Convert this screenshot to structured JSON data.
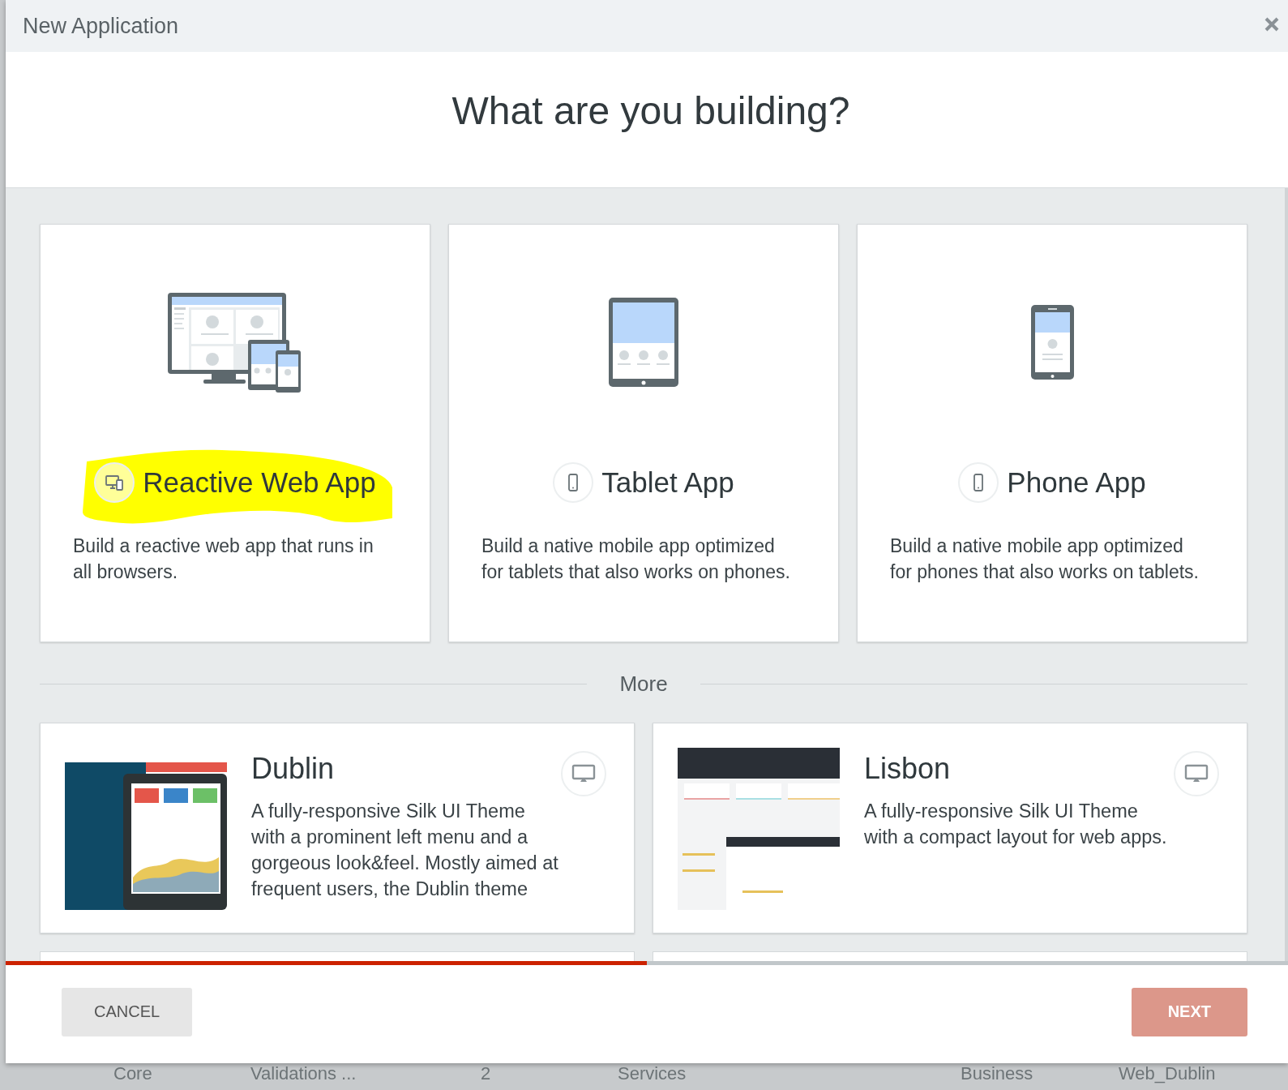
{
  "window": {
    "title": "New Application"
  },
  "heading": "What are you building?",
  "app_types": [
    {
      "kind": "web",
      "title": "Reactive Web App",
      "description": "Build a reactive web app that runs in all browsers.",
      "highlighted": true
    },
    {
      "kind": "tablet",
      "title": "Tablet App",
      "description": "Build a native mobile app optimized for tablets that also works on phones.",
      "highlighted": false
    },
    {
      "kind": "phone",
      "title": "Phone App",
      "description": "Build a native mobile app optimized for phones that also works on tablets.",
      "highlighted": false
    }
  ],
  "more_label": "More",
  "themes": [
    {
      "name": "Dublin",
      "description": "A fully-responsive Silk UI Theme with a prominent left menu and a gorgeous look&feel. Mostly aimed at frequent users, the Dublin theme",
      "kind": "dark"
    },
    {
      "name": "Lisbon",
      "description": "A fully-responsive Silk UI Theme with a compact layout for web apps.",
      "kind": "light"
    }
  ],
  "progress": {
    "level": 0.5
  },
  "buttons": [
    {
      "label": "CANCEL",
      "kind": "secondary",
      "disabled": false
    },
    {
      "label": "NEXT",
      "kind": "primary",
      "disabled": true
    }
  ],
  "background_row": [
    "Core",
    "Validations ...",
    "2",
    "Services",
    "Business",
    "Web_Dublin"
  ]
}
